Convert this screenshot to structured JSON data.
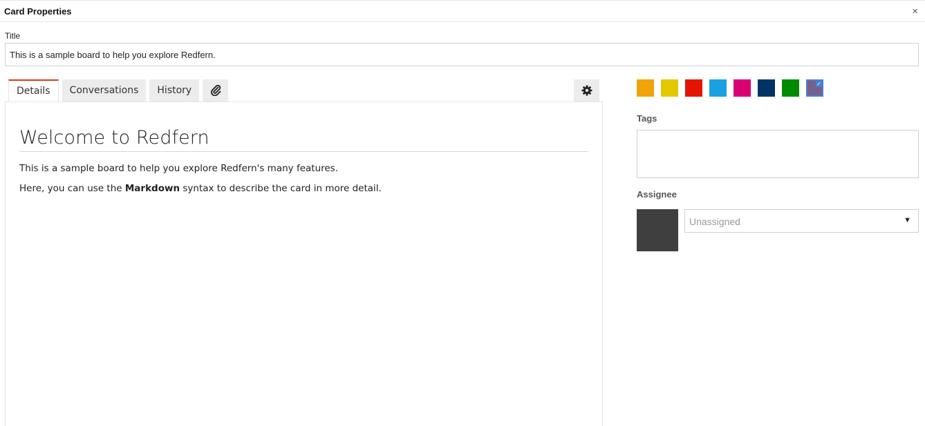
{
  "dialog": {
    "title": "Card Properties",
    "close_glyph": "×"
  },
  "title_field": {
    "label": "Title",
    "value": "This is a sample board to help you explore Redfern."
  },
  "tabs": [
    {
      "label": "Details"
    },
    {
      "label": "Conversations"
    },
    {
      "label": "History"
    },
    {
      "icon": "paperclip-icon"
    }
  ],
  "settings_icon": "gear-icon",
  "details": {
    "heading": "Welcome to Redfern",
    "paragraph1": "This is a sample board to help you explore Redfern's many features.",
    "paragraph2_before": "Here, you can use the ",
    "paragraph2_bold": "Markdown",
    "paragraph2_after": " syntax to describe the card in more detail."
  },
  "colors": [
    {
      "hex": "#f0a30a"
    },
    {
      "hex": "#e3c800"
    },
    {
      "hex": "#e51400"
    },
    {
      "hex": "#1ba1e2"
    },
    {
      "hex": "#d80073"
    },
    {
      "hex": "#003366"
    },
    {
      "hex": "#008a00"
    },
    {
      "hex": "#76608a",
      "selected": true
    }
  ],
  "tags": {
    "label": "Tags"
  },
  "assignee": {
    "label": "Assignee",
    "value": "Unassigned",
    "arrow": "▼"
  },
  "accent_color": "#d23a1e"
}
